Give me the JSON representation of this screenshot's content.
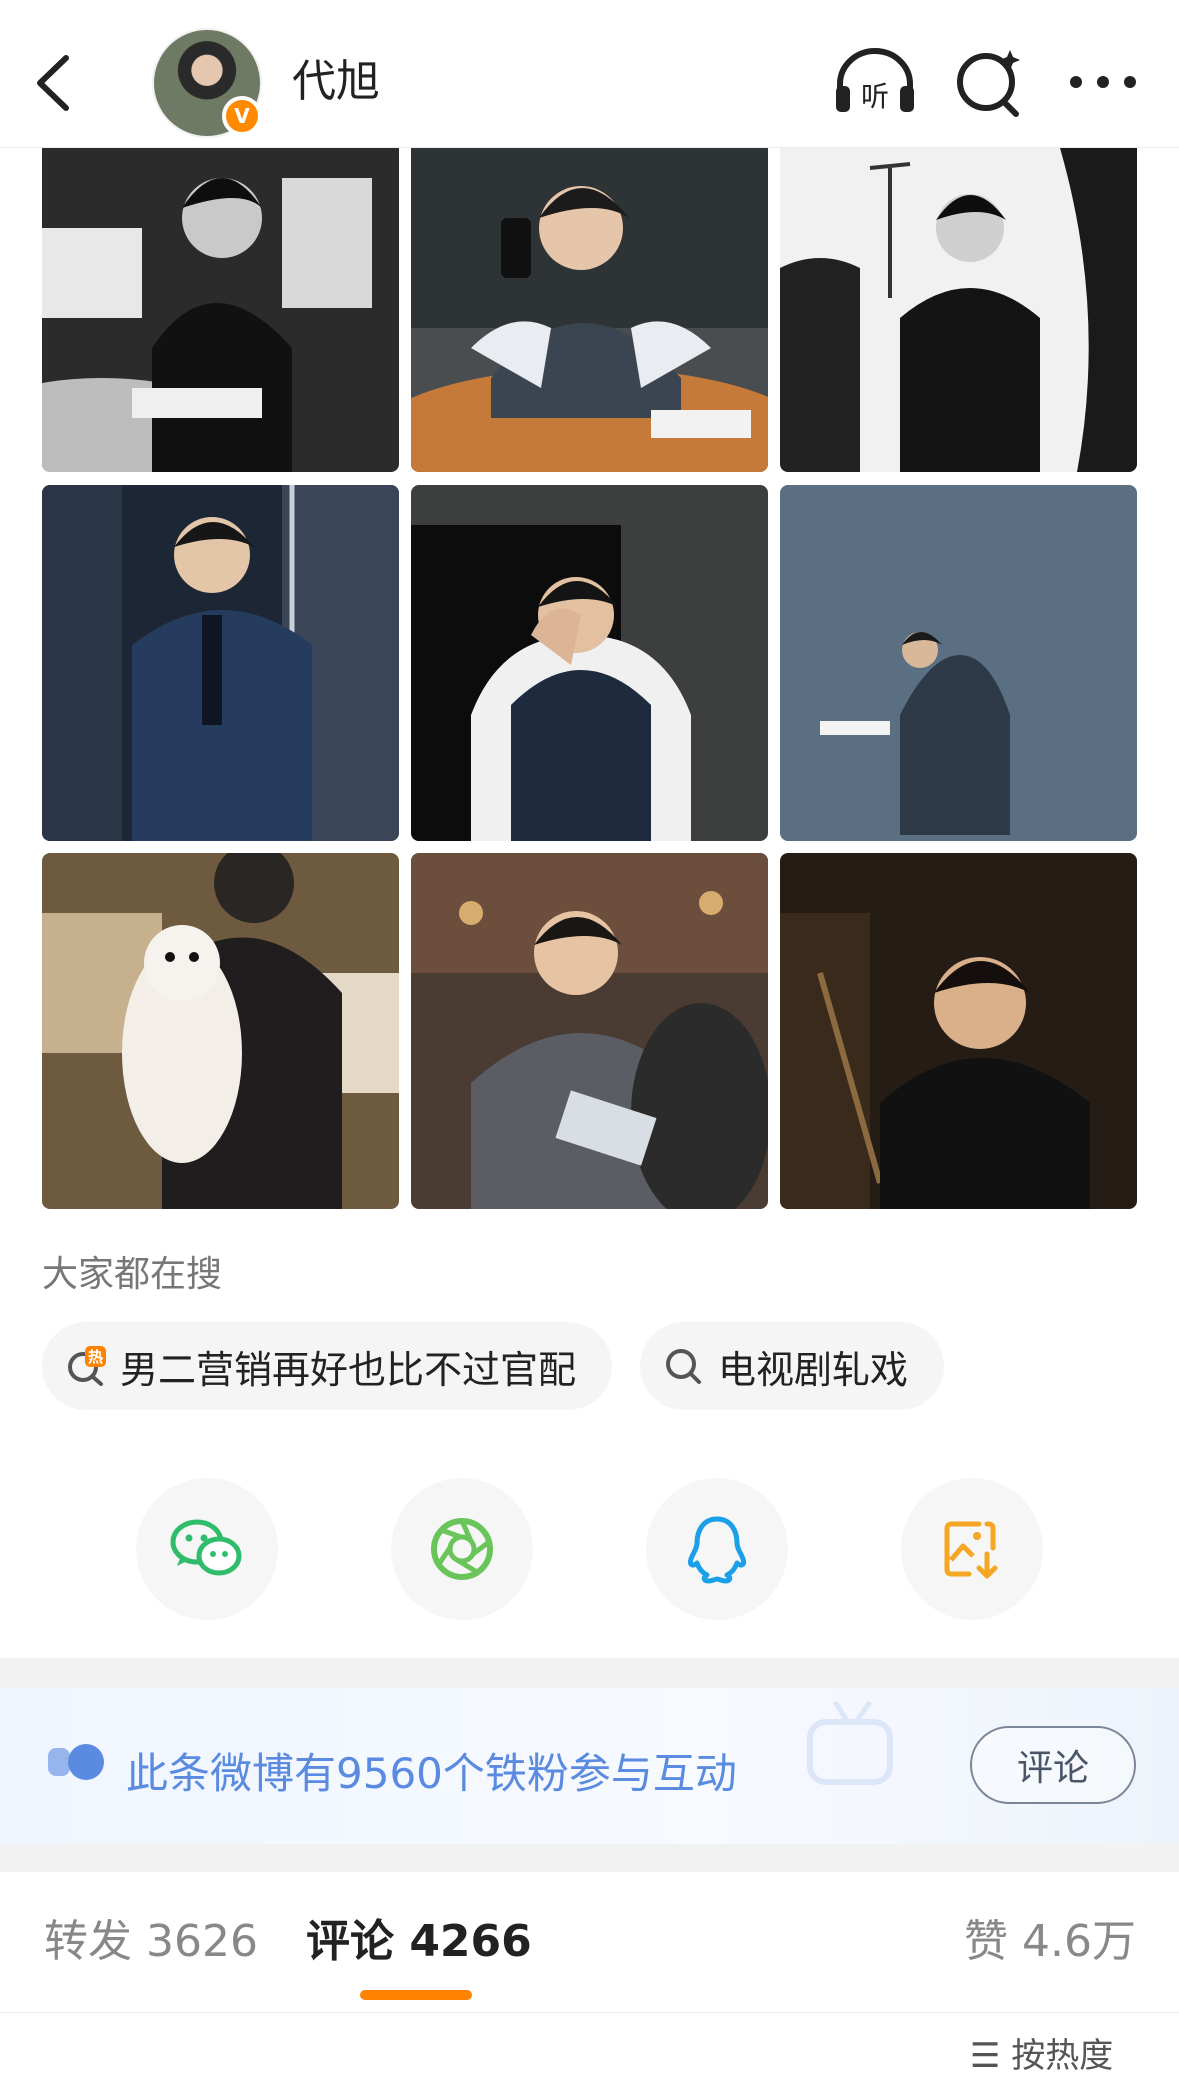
{
  "header": {
    "back_icon": "chevron-left-icon",
    "username": "代旭",
    "verified_badge": "V",
    "listen_label": "听",
    "listen_icon": "headphones-icon",
    "search_icon": "search-sparkle-icon",
    "more_icon": "more-dots-icon"
  },
  "photos": [
    {
      "desc": "bw-writing"
    },
    {
      "desc": "phone-table"
    },
    {
      "desc": "bw-set"
    },
    {
      "desc": "blue-suit"
    },
    {
      "desc": "vest-face"
    },
    {
      "desc": "wall-walk"
    },
    {
      "desc": "dog-hug"
    },
    {
      "desc": "restaurant"
    },
    {
      "desc": "dark-glasses"
    }
  ],
  "search": {
    "title": "大家都在搜",
    "hot_badge": "热",
    "chips": [
      {
        "label": "男二营销再好也比不过官配",
        "icon": "hot-search-icon"
      },
      {
        "label": "电视剧轧戏",
        "icon": "search-icon"
      }
    ]
  },
  "share": [
    {
      "icon": "wechat-icon",
      "color": "#2fbd6b"
    },
    {
      "icon": "moments-icon",
      "color": "#69c55a"
    },
    {
      "icon": "qq-icon",
      "color": "#1aa0e8"
    },
    {
      "icon": "save-image-icon",
      "color": "#f5a623"
    }
  ],
  "fan_banner": {
    "text": "此条微博有9560个铁粉参与互动",
    "button": "评论"
  },
  "tabs": {
    "repost": "转发 3626",
    "comment": "评论 4266",
    "like": "赞 4.6万"
  },
  "sort_label": "按热度",
  "colors": {
    "accent": "#ff8200",
    "banner_text": "#5a8be0"
  }
}
